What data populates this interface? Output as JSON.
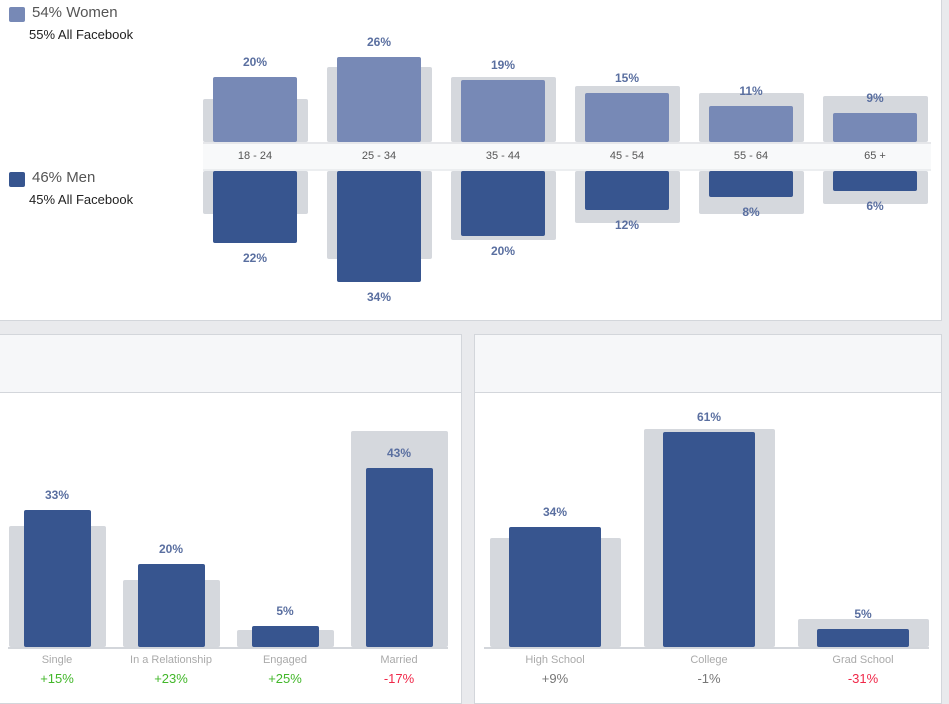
{
  "colors": {
    "women": "#7789b6",
    "men": "#37558f",
    "benchmark": "#d5d8dd",
    "positive": "#42b72a",
    "negative": "#f02849",
    "neutral": "#777777"
  },
  "legend": {
    "women_label": "54% Women",
    "women_sub": "55% All Facebook",
    "men_label": "46% Men",
    "men_sub": "45% All Facebook"
  },
  "chart_data": [
    {
      "type": "bar",
      "categories": [
        "18 - 24",
        "25 - 34",
        "35 - 44",
        "45 - 54",
        "55 - 64",
        "65 +"
      ],
      "series": [
        {
          "name": "Women",
          "values": [
            20,
            26,
            19,
            15,
            11,
            9
          ],
          "labels": [
            "20%",
            "26%",
            "19%",
            "15%",
            "11%",
            "9%"
          ]
        },
        {
          "name": "Men",
          "values": [
            22,
            34,
            20,
            12,
            8,
            6
          ],
          "labels": [
            "22%",
            "34%",
            "20%",
            "12%",
            "8%",
            "6%"
          ]
        }
      ],
      "benchmark": {
        "women": [
          13,
          23,
          20,
          17,
          15,
          14
        ],
        "men": [
          13,
          27,
          21,
          16,
          13,
          10
        ]
      }
    },
    {
      "type": "bar",
      "categories": [
        "Single",
        "In a Relationship",
        "Engaged",
        "Married"
      ],
      "values": [
        33,
        20,
        5,
        43
      ],
      "labels": [
        "33%",
        "20%",
        "5%",
        "43%"
      ],
      "benchmark": [
        29,
        16,
        4,
        52
      ],
      "deltas": [
        "+15%",
        "+23%",
        "+25%",
        "-17%"
      ],
      "delta_sign": [
        "positive",
        "positive",
        "positive",
        "negative"
      ]
    },
    {
      "type": "bar",
      "categories": [
        "High School",
        "College",
        "Grad School"
      ],
      "values": [
        34,
        61,
        5
      ],
      "labels": [
        "34%",
        "61%",
        "5%"
      ],
      "benchmark": [
        31,
        62,
        8
      ],
      "deltas": [
        "+9%",
        "-1%",
        "-31%"
      ],
      "delta_sign": [
        "neutral",
        "neutral",
        "negative"
      ]
    }
  ]
}
